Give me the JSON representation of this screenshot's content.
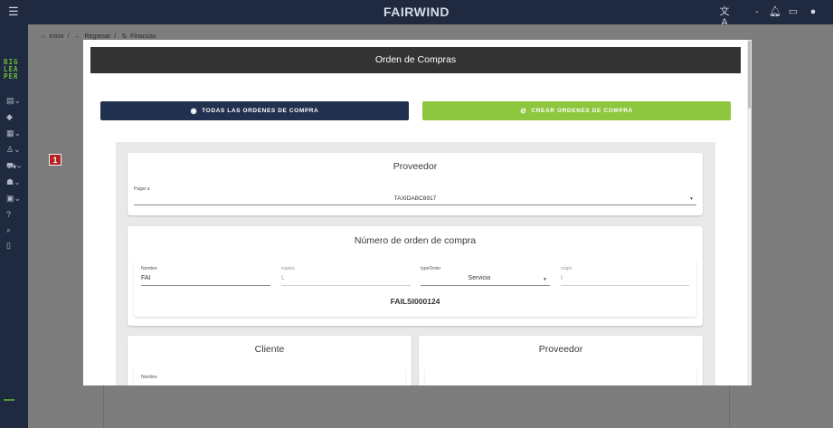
{
  "topbar": {
    "brand": "FAIRWIND",
    "icons": [
      "menu-icon",
      "translate-icon",
      "bell-icon",
      "chat-icon",
      "account-icon"
    ]
  },
  "sidebar": {
    "logo_lines": [
      "BIG",
      "LEA",
      "PER"
    ]
  },
  "breadcrumb": {
    "home": "Inicio",
    "back": "Regresar",
    "current": "Finanzas"
  },
  "badge": "1",
  "modal": {
    "title": "Orden de Compras",
    "buttons": {
      "all_label": "TODAS LAS ORDENES DE COMPRA",
      "create_label": "CREAR ORDENES DE COMPRA"
    },
    "proveedor_section": {
      "title": "Proveedor",
      "field_label": "Pagar a",
      "field_value": "TAXIDABC6917"
    },
    "numero_section": {
      "title": "Número de orden de compra",
      "fields": [
        {
          "label": "Nombre",
          "value": "FAI"
        },
        {
          "label": "logistic",
          "value": "L"
        },
        {
          "label": "typeOrder",
          "value": "Servicio"
        },
        {
          "label": "origin",
          "value": "I"
        }
      ],
      "code": "FAILSI000124"
    },
    "cliente_section": {
      "title": "Cliente",
      "field_label": "Nombre"
    },
    "proveedor2_section": {
      "title": "Proveedor"
    }
  }
}
